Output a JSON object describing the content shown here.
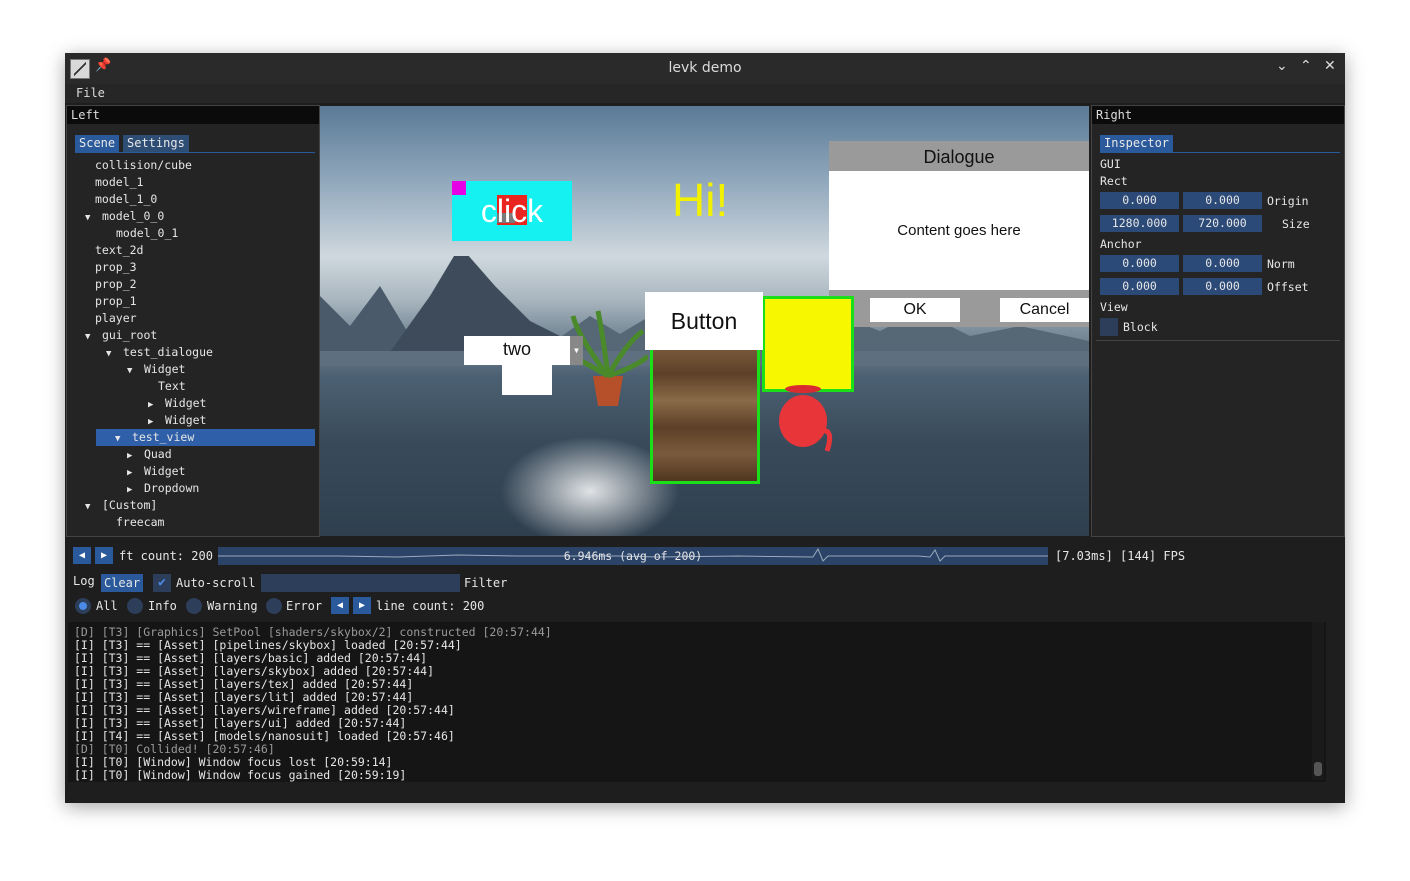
{
  "window": {
    "title": "levk demo",
    "pin_glyph": "📌",
    "buttons": {
      "minimize": "⌄",
      "maximize": "⌃",
      "close": "✕"
    }
  },
  "menubar": {
    "file": "File"
  },
  "left": {
    "title": "Left",
    "tabs": [
      {
        "label": "Scene"
      },
      {
        "label": "Settings"
      }
    ],
    "tree": [
      {
        "label": "collision/cube",
        "arrow": "",
        "indent": 0
      },
      {
        "label": "model_1",
        "arrow": "",
        "indent": 0
      },
      {
        "label": "model_1_0",
        "arrow": "",
        "indent": 0
      },
      {
        "label": "model_0_0",
        "arrow": "▼",
        "indent": 0
      },
      {
        "label": "model_0_1",
        "arrow": "",
        "indent": 1
      },
      {
        "label": "text_2d",
        "arrow": "",
        "indent": 0
      },
      {
        "label": "prop_3",
        "arrow": "",
        "indent": 0
      },
      {
        "label": "prop_2",
        "arrow": "",
        "indent": 0
      },
      {
        "label": "prop_1",
        "arrow": "",
        "indent": 0
      },
      {
        "label": "player",
        "arrow": "",
        "indent": 0
      },
      {
        "label": "gui_root",
        "arrow": "▼",
        "indent": 0
      },
      {
        "label": "test_dialogue",
        "arrow": "▼",
        "indent": 1
      },
      {
        "label": "Widget",
        "arrow": "▼",
        "indent": 2
      },
      {
        "label": "Text",
        "arrow": "",
        "indent": 3
      },
      {
        "label": "Widget",
        "arrow": "▶",
        "indent": 3
      },
      {
        "label": "Widget",
        "arrow": "▶",
        "indent": 3
      },
      {
        "label": "test_view",
        "arrow": "▼",
        "indent": 1,
        "selected": true
      },
      {
        "label": "Quad",
        "arrow": "▶",
        "indent": 2
      },
      {
        "label": "Widget",
        "arrow": "▶",
        "indent": 2
      },
      {
        "label": "Dropdown",
        "arrow": "▶",
        "indent": 2
      },
      {
        "label": "[Custom]",
        "arrow": "▼",
        "indent": 0
      },
      {
        "label": "freecam",
        "arrow": "",
        "indent": 1
      }
    ]
  },
  "right": {
    "title": "Right",
    "tab": "Inspector",
    "gui_label": "GUI",
    "rect_label": "Rect",
    "origin": {
      "x": "0.000",
      "y": "0.000",
      "label": "Origin"
    },
    "size": {
      "x": "1280.000",
      "y": "720.000",
      "label": "Size"
    },
    "anchor_label": "Anchor",
    "norm": {
      "x": "0.000",
      "y": "0.000",
      "label": "Norm"
    },
    "offset": {
      "x": "0.000",
      "y": "0.000",
      "label": "Offset"
    },
    "view_label": "View",
    "block_label": "Block"
  },
  "viewport": {
    "click_text": "click",
    "hi_text": "Hi!",
    "dialogue": {
      "title": "Dialogue",
      "content": "Content goes here",
      "ok": "OK",
      "cancel": "Cancel"
    },
    "button_text": "Button",
    "dropdown_value": "two",
    "dropdown_arrow": "▾"
  },
  "stats": {
    "ft_count": "ft count: 200",
    "graph_label": "6.946ms (avg of 200)",
    "fps": "[7.03ms] [144] FPS"
  },
  "log": {
    "label": "Log",
    "clear": "Clear",
    "autoscroll": "Auto-scroll",
    "autoscroll_checked": true,
    "filter": "Filter",
    "filter_value": "",
    "levels": [
      {
        "label": "All",
        "on": true
      },
      {
        "label": "Info",
        "on": false
      },
      {
        "label": "Warning",
        "on": false
      },
      {
        "label": "Error",
        "on": false
      }
    ],
    "line_count": "line count: 200",
    "lines": [
      {
        "text": "[D] [T3] [Graphics] SetPool [shaders/skybox/2] constructed [20:57:44]",
        "color": "#9a9a9a"
      },
      {
        "text": "[I] [T3] == [Asset] [pipelines/skybox] loaded [20:57:44]",
        "color": "#e6e6e6"
      },
      {
        "text": "[I] [T3] == [Asset] [layers/basic] added [20:57:44]",
        "color": "#e6e6e6"
      },
      {
        "text": "[I] [T3] == [Asset] [layers/skybox] added [20:57:44]",
        "color": "#e6e6e6"
      },
      {
        "text": "[I] [T3] == [Asset] [layers/tex] added [20:57:44]",
        "color": "#e6e6e6"
      },
      {
        "text": "[I] [T3] == [Asset] [layers/lit] added [20:57:44]",
        "color": "#e6e6e6"
      },
      {
        "text": "[I] [T3] == [Asset] [layers/wireframe] added [20:57:44]",
        "color": "#e6e6e6"
      },
      {
        "text": "[I] [T3] == [Asset] [layers/ui] added [20:57:44]",
        "color": "#e6e6e6"
      },
      {
        "text": "[I] [T4] == [Asset] [models/nanosuit] loaded [20:57:46]",
        "color": "#e6e6e6"
      },
      {
        "text": "[D] [T0] Collided! [20:57:46]",
        "color": "#9a9a9a"
      },
      {
        "text": "[I] [T0] [Window] Window focus lost [20:59:14]",
        "color": "#e6e6e6"
      },
      {
        "text": "[I] [T0] [Window] Window focus gained [20:59:19]",
        "color": "#e6e6e6"
      }
    ]
  }
}
